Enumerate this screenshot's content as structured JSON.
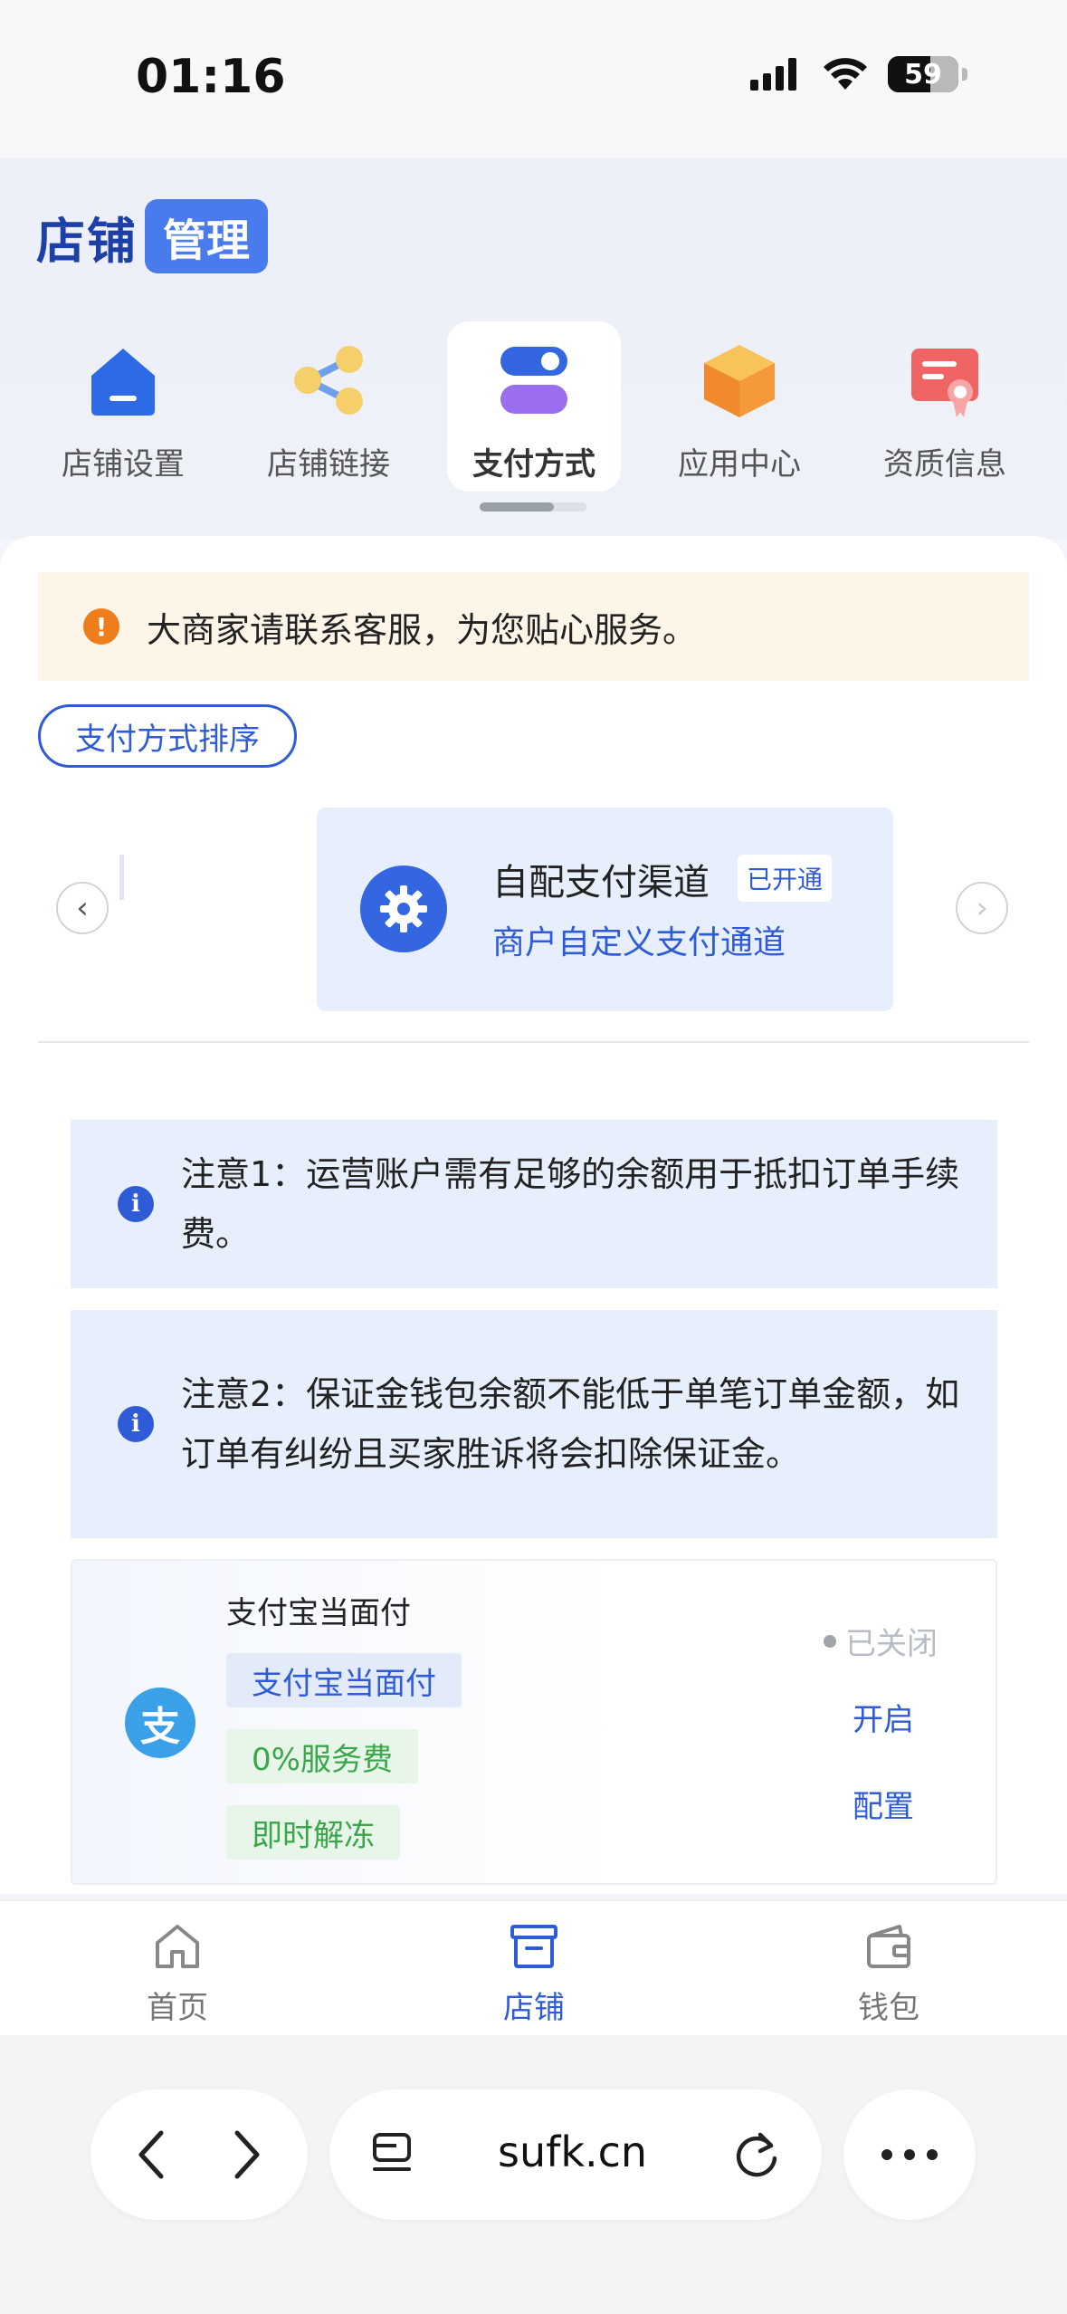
{
  "status_bar": {
    "time": "01:16",
    "battery": "59"
  },
  "header": {
    "brand_part1": "店铺",
    "brand_part2": "管理",
    "tabs": [
      {
        "label": "店铺设置",
        "icon": "shop-house-icon",
        "active": false
      },
      {
        "label": "店铺链接",
        "icon": "share-nodes-icon",
        "active": false
      },
      {
        "label": "支付方式",
        "icon": "toggle-switch-icon",
        "active": true
      },
      {
        "label": "应用中心",
        "icon": "box-cube-icon",
        "active": false
      },
      {
        "label": "资质信息",
        "icon": "certificate-icon",
        "active": false
      }
    ]
  },
  "notice": {
    "text": "大商家请联系客服，为您贴心服务。"
  },
  "sort_button": {
    "label": "支付方式排序"
  },
  "channel_card": {
    "title": "自配支付渠道",
    "badge": "已开通",
    "subtitle": "商户自定义支付通道"
  },
  "notes": [
    {
      "text": "注意1：运营账户需有足够的余额用于抵扣订单手续费。"
    },
    {
      "text": "注意2：保证金钱包余额不能低于单笔订单金额，如订单有纠纷且买家胜诉将会扣除保证金。"
    }
  ],
  "payment_method": {
    "name": "支付宝当面付",
    "icon_glyph": "支",
    "tags": [
      "支付宝当面付",
      "0%服务费",
      "即时解冻"
    ],
    "status": "已关闭",
    "actions": {
      "open": "开启",
      "config": "配置"
    }
  },
  "bottom_nav": [
    {
      "label": "首页",
      "active": false
    },
    {
      "label": "店铺",
      "active": true
    },
    {
      "label": "钱包",
      "active": false
    }
  ],
  "browser": {
    "url": "sufk.cn"
  },
  "colors": {
    "accent": "#2f5bd7",
    "brand_dark": "#1c3fa8",
    "warning": "#f07d1c",
    "success": "#3aa64a"
  }
}
